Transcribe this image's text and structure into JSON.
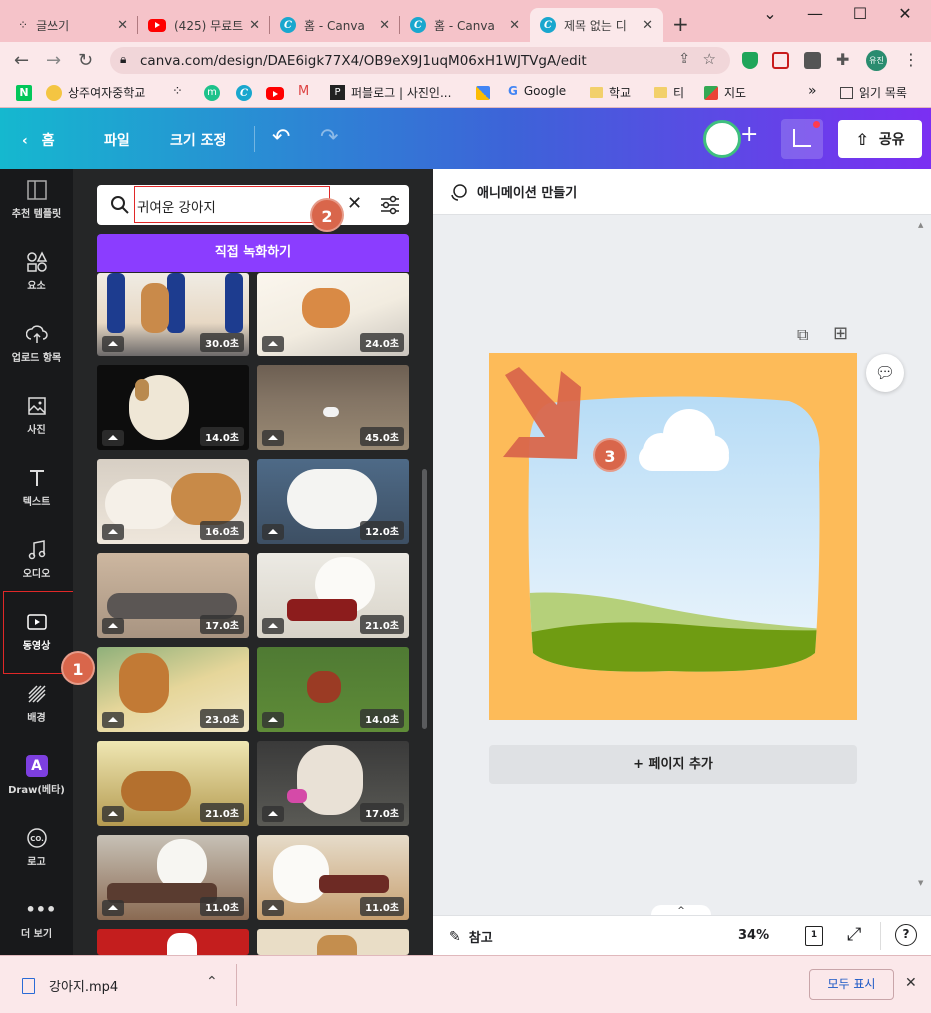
{
  "browser": {
    "tabs": [
      {
        "title": "글쓰기",
        "icon": "grid-icon"
      },
      {
        "title": "(425) 무료트",
        "icon": "youtube-icon"
      },
      {
        "title": "홈 - Canva",
        "icon": "canva-icon"
      },
      {
        "title": "홈 - Canva",
        "icon": "canva-icon"
      },
      {
        "title": "제목 없는 디",
        "icon": "canva-icon"
      }
    ],
    "new_tab": "+",
    "url": "canva.com/design/DAE6igk77X4/OB9eX9J1uqM06xH1WJTVgA/edit",
    "profile": "유진",
    "bookmarks": [
      "상주여자중학교",
      "퍼블로그 | 사진인...",
      "Google",
      "학교",
      "티",
      "지도"
    ],
    "bookmarks_more": "»",
    "reading_list": "읽기 목록"
  },
  "canva_header": {
    "home": "홈",
    "file": "파일",
    "resize": "크기 조정",
    "plus": "+",
    "share": "공유"
  },
  "left_nav": [
    {
      "label": "추천 템플릿",
      "icon": "template-icon"
    },
    {
      "label": "요소",
      "icon": "elements-icon"
    },
    {
      "label": "업로드 항목",
      "icon": "upload-icon"
    },
    {
      "label": "사진",
      "icon": "photo-icon"
    },
    {
      "label": "텍스트",
      "icon": "text-icon"
    },
    {
      "label": "오디오",
      "icon": "audio-icon"
    },
    {
      "label": "동영상",
      "icon": "video-icon"
    },
    {
      "label": "배경",
      "icon": "background-icon"
    },
    {
      "label": "Draw(베타)",
      "icon": "draw-icon"
    },
    {
      "label": "로고",
      "icon": "logo-icon"
    },
    {
      "label": "더 보기",
      "icon": "more-icon"
    }
  ],
  "panel": {
    "search_value": "귀여운 강아지",
    "record_button": "직접 녹화하기",
    "videos": [
      {
        "duration": "30.0초"
      },
      {
        "duration": "24.0초"
      },
      {
        "duration": "14.0초"
      },
      {
        "duration": "45.0초"
      },
      {
        "duration": "16.0초"
      },
      {
        "duration": "12.0초"
      },
      {
        "duration": "17.0초"
      },
      {
        "duration": "21.0초"
      },
      {
        "duration": "23.0초"
      },
      {
        "duration": "14.0초"
      },
      {
        "duration": "21.0초"
      },
      {
        "duration": "17.0초"
      },
      {
        "duration": "11.0초"
      },
      {
        "duration": "11.0초"
      },
      {
        "duration": ""
      },
      {
        "duration": ""
      }
    ]
  },
  "editor": {
    "animate": "애니메이션 만들기",
    "add_page": "+ 페이지 추가",
    "notes": "참고",
    "zoom": "34%",
    "page_count": "1",
    "help": "?"
  },
  "download": {
    "filename": "강아지.mp4",
    "show_all": "모두 표시"
  },
  "annotations": [
    "1",
    "2",
    "3"
  ],
  "colors": {
    "accent": "#8b3dff",
    "canvas_bg": "#fdbb59",
    "badge": "#d9664b"
  }
}
